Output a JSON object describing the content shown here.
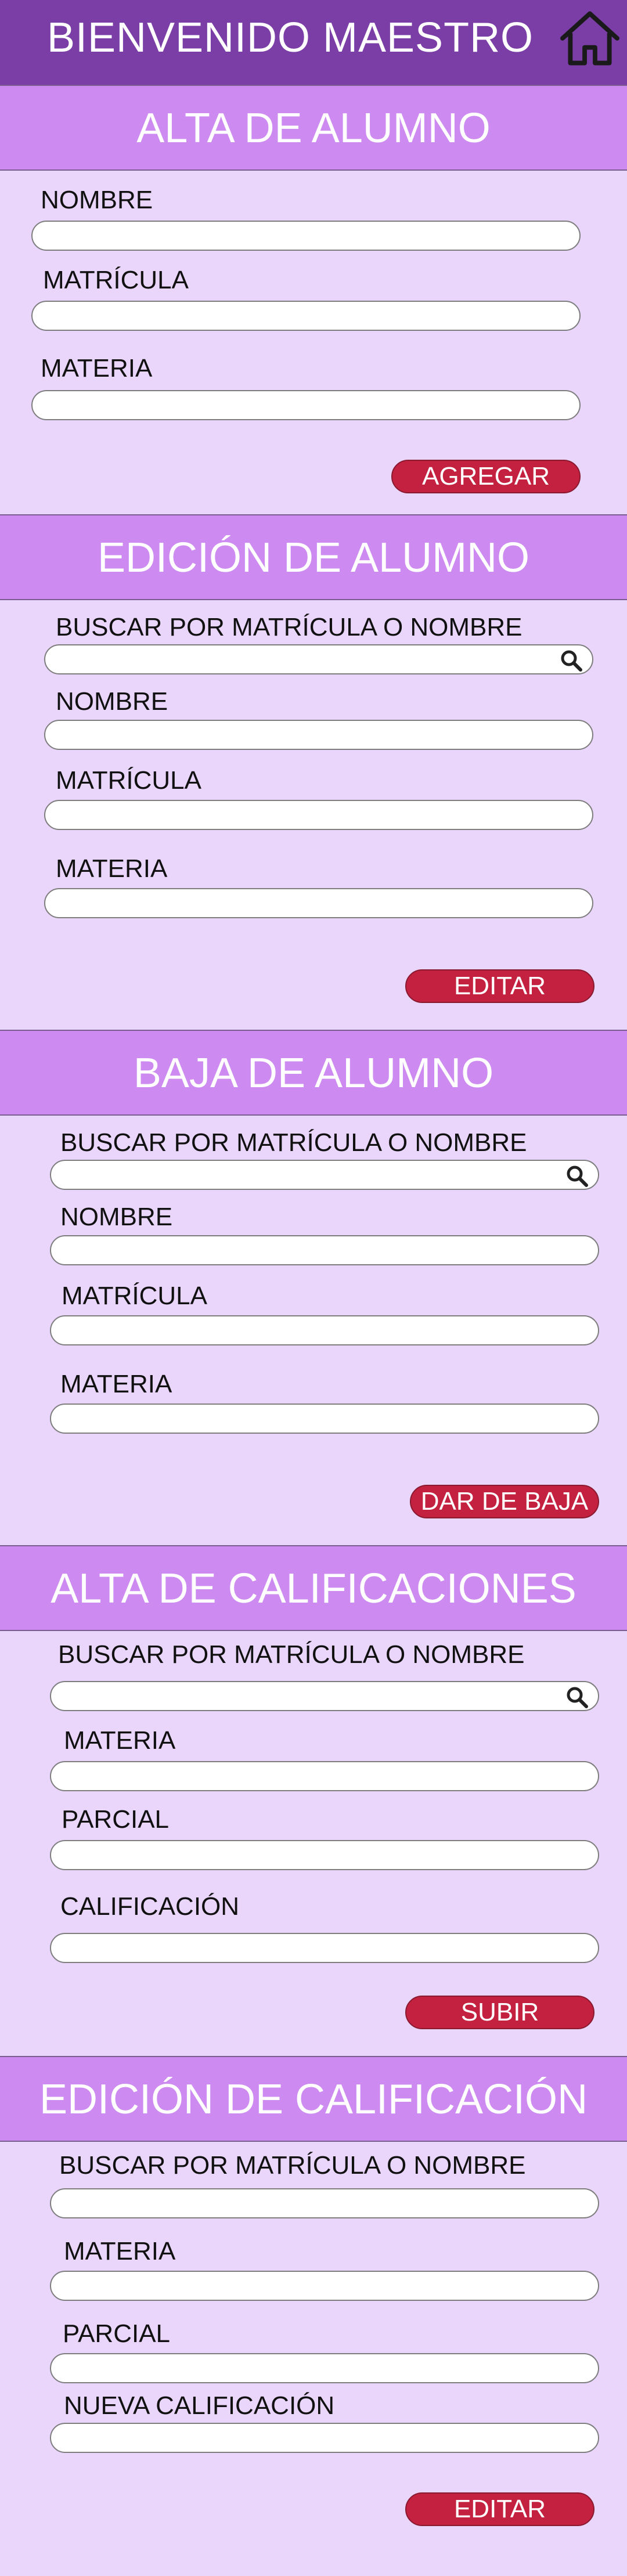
{
  "header": {
    "title": "BIENVENIDO MAESTRO",
    "home_icon": "home-icon"
  },
  "alta_alumno": {
    "title": "ALTA DE ALUMNO",
    "nombre_label": "NOMBRE",
    "matricula_label": "MATRÍCULA",
    "materia_label": "MATERIA",
    "button": "AGREGAR"
  },
  "edicion_alumno": {
    "title": "EDICIÓN DE ALUMNO",
    "search_label": "BUSCAR POR MATRÍCULA O NOMBRE",
    "nombre_label": "NOMBRE",
    "matricula_label": "MATRÍCULA",
    "materia_label": "MATERIA",
    "button": "EDITAR"
  },
  "baja_alumno": {
    "title": "BAJA DE ALUMNO",
    "search_label": "BUSCAR POR MATRÍCULA O NOMBRE",
    "nombre_label": "NOMBRE",
    "matricula_label": "MATRÍCULA",
    "materia_label": "MATERIA",
    "button": "DAR DE BAJA"
  },
  "alta_calificaciones": {
    "title": "ALTA DE CALIFICACIONES",
    "search_label": "BUSCAR POR MATRÍCULA O NOMBRE",
    "materia_label": "MATERIA",
    "parcial_label": "PARCIAL",
    "calificacion_label": "CALIFICACIÓN",
    "button": "SUBIR"
  },
  "edicion_calificacion": {
    "title": "EDICIÓN DE CALIFICACIÓN",
    "search_label": "BUSCAR POR MATRÍCULA O NOMBRE",
    "materia_label": "MATERIA",
    "parcial_label": "PARCIAL",
    "nueva_label": "NUEVA CALIFICACIÓN",
    "button": "EDITAR"
  },
  "colors": {
    "topbar": "#7a3ea6",
    "section_header": "#cd8bf1",
    "background": "#ead5fb",
    "button": "#c42040"
  }
}
